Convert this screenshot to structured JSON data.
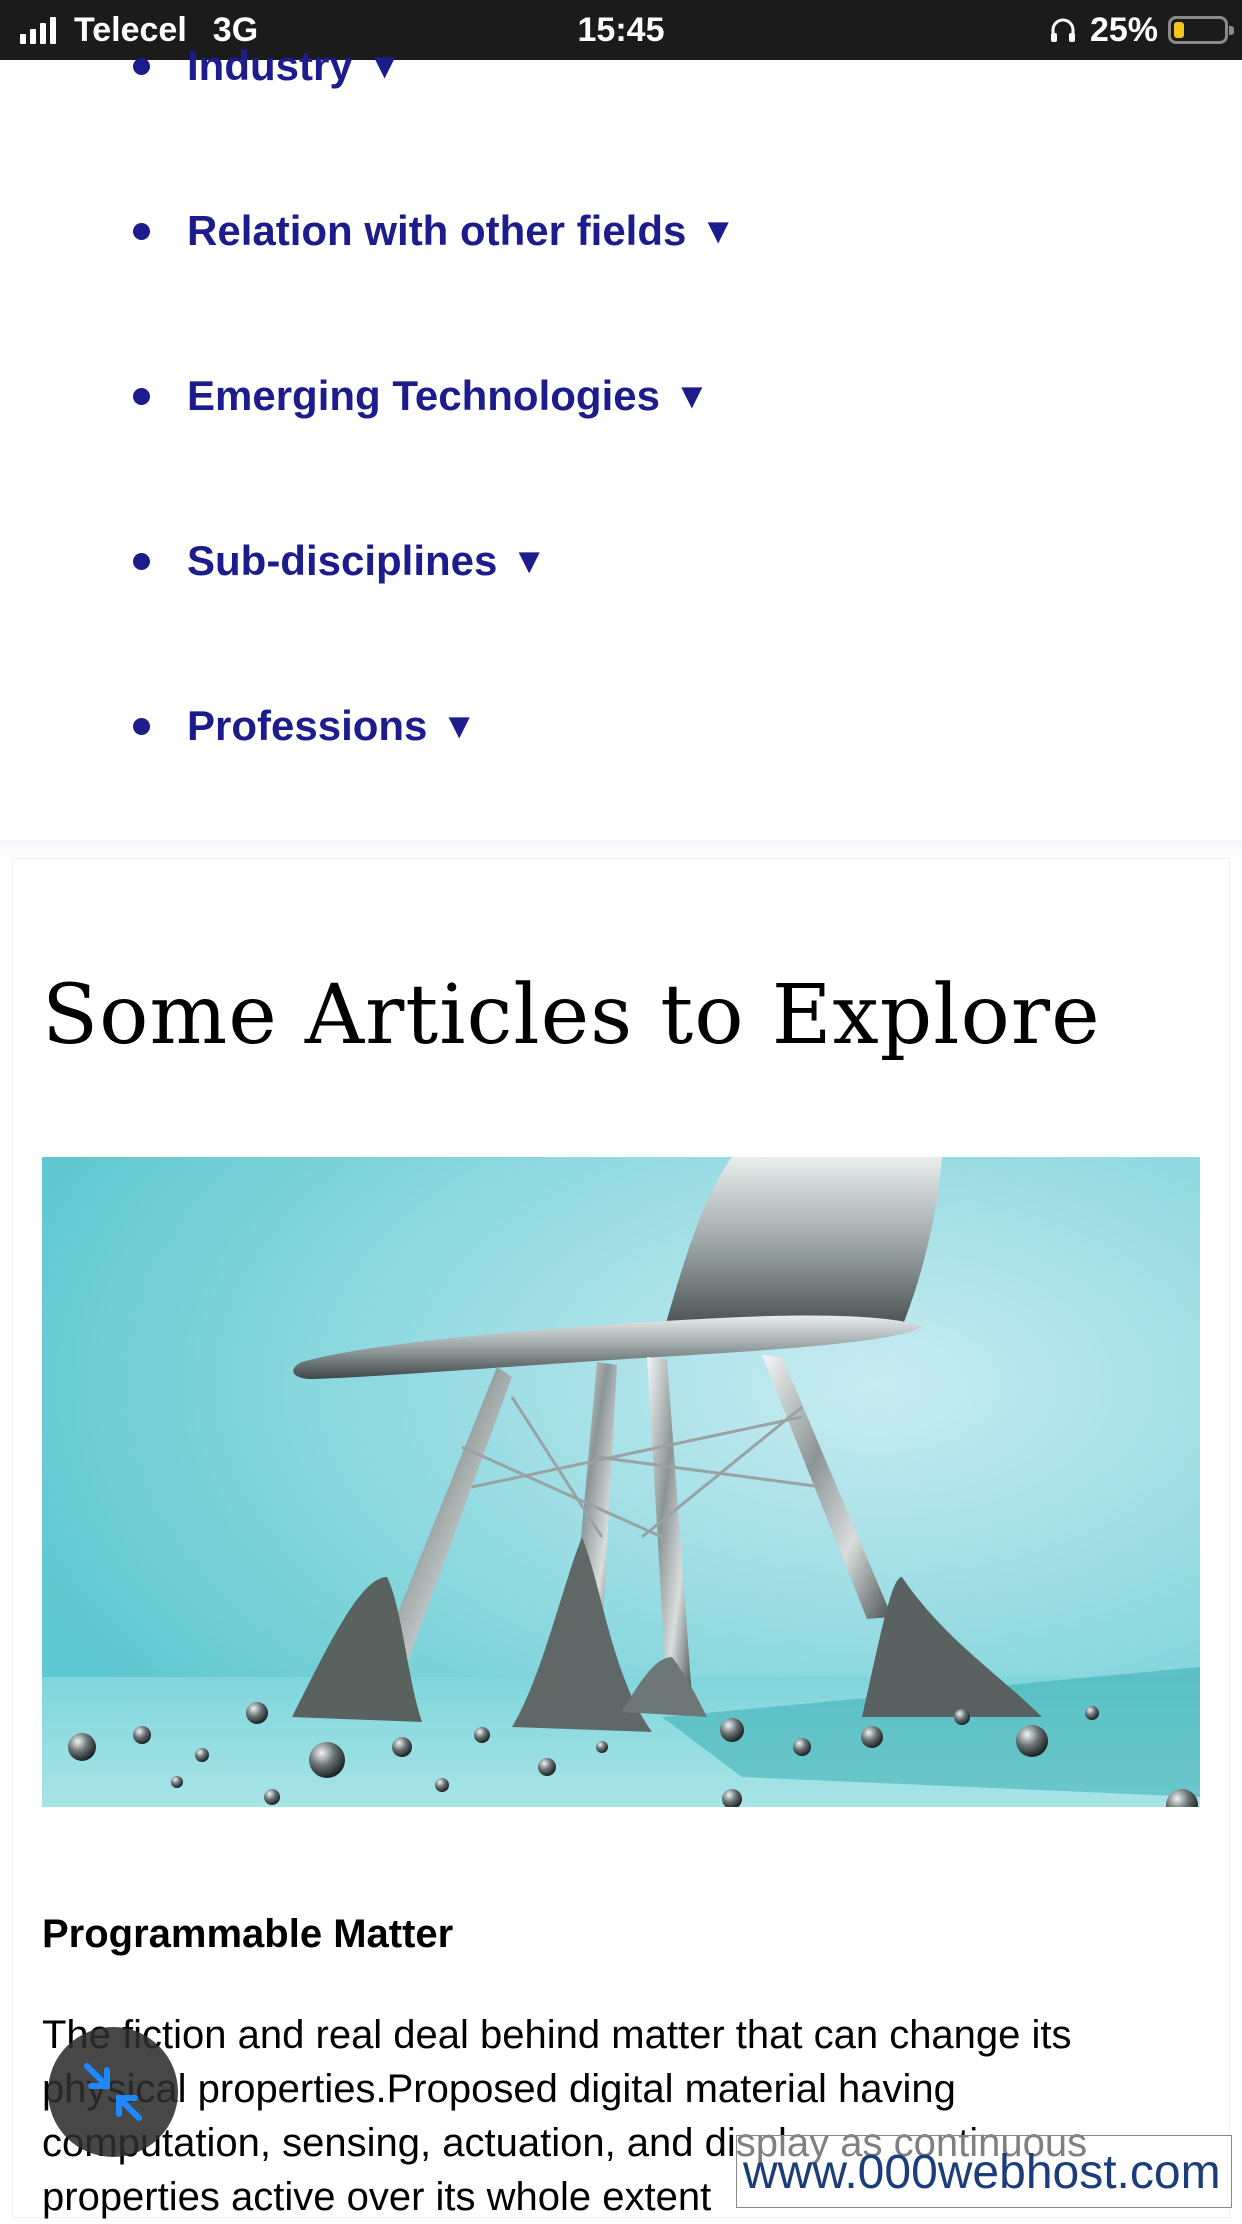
{
  "status_bar": {
    "carrier": "Telecel",
    "network": "3G",
    "time": "15:45",
    "battery": "25%"
  },
  "nav": {
    "items": [
      {
        "label": "Industry",
        "caret": "▼"
      },
      {
        "label": "Relation with other fields",
        "caret": "▼"
      },
      {
        "label": "Emerging Technologies",
        "caret": "▼"
      },
      {
        "label": "Sub-disciplines",
        "caret": "▼"
      },
      {
        "label": "Professions",
        "caret": "▼"
      }
    ]
  },
  "articles_section": {
    "title": "Some Articles to Explore",
    "article": {
      "image_subject": "chrome-chair-dissolving-into-spheres",
      "title": "Programmable Matter",
      "description": "The fiction and real deal behind matter that can change its physical properties.Proposed digital material having computation, sensing, actuation, and display as continuous properties active over its whole extent"
    }
  },
  "fab": {
    "icon": "collapse-arrows-icon"
  },
  "watermark": {
    "text": "www.000webhost.com"
  },
  "colors": {
    "nav_text": "#1c1c8c",
    "status_bar_bg": "#1b1b1b",
    "battery_fill": "#f5c518",
    "image_bg": "#7fd3dc",
    "fab_arrows": "#1e88ff"
  }
}
